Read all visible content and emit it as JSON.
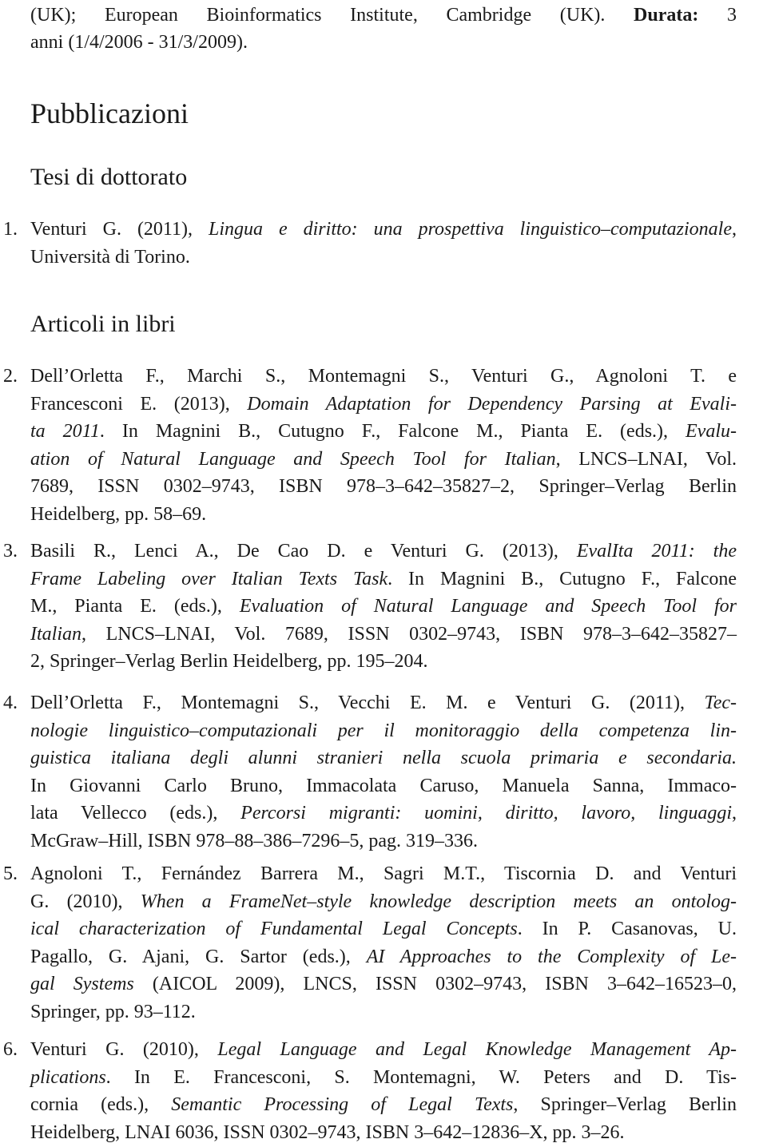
{
  "intro": {
    "line1_text": "(UK); European Bioinformatics Institute, Cambridge (UK).",
    "line1_bold": "Durata:",
    "line1_tail": " 3",
    "line2": "anni (1/4/2006 - 31/3/2009)."
  },
  "section_title": "Pubblicazioni",
  "subsections": [
    {
      "title": "Tesi di dottorato"
    },
    {
      "title": "Articoli in libri"
    }
  ],
  "entries": [
    {
      "number": "1.",
      "lines": [
        [
          {
            "t": "Venturi G. (2011), "
          },
          {
            "t": "Lingua e diritto: una prospettiva linguistico–computazionale",
            "i": true
          },
          {
            "t": ","
          }
        ],
        [
          {
            "t": "Università di Torino."
          }
        ]
      ]
    },
    {
      "number": "2.",
      "lines": [
        [
          {
            "t": "Dell’Orletta F., Marchi S., Montemagni S., Venturi G., Agnoloni T. e"
          }
        ],
        [
          {
            "t": "Francesconi E. (2013), "
          },
          {
            "t": "Domain Adaptation for Dependency Parsing at Evali-",
            "i": true
          }
        ],
        [
          {
            "t": "ta 2011",
            "i": true
          },
          {
            "t": ". In Magnini B., Cutugno F., Falcone M., Pianta E. (eds.), "
          },
          {
            "t": "Evalu-",
            "i": true
          }
        ],
        [
          {
            "t": "ation of Natural Language and Speech Tool for Italian",
            "i": true
          },
          {
            "t": ", LNCS–LNAI, Vol."
          }
        ],
        [
          {
            "t": "7689, ISSN 0302–9743, ISBN 978–3–642–35827–2, Springer–Verlag Berlin"
          }
        ],
        [
          {
            "t": "Heidelberg, pp. 58–69."
          }
        ]
      ]
    },
    {
      "number": "3.",
      "lines": [
        [
          {
            "t": "Basili R., Lenci A., De Cao D. e Venturi G. (2013), "
          },
          {
            "t": "EvalIta 2011: the",
            "i": true
          }
        ],
        [
          {
            "t": "Frame Labeling over Italian Texts Task",
            "i": true
          },
          {
            "t": ". In Magnini B., Cutugno F., Falcone"
          }
        ],
        [
          {
            "t": "M., Pianta E. (eds.), "
          },
          {
            "t": "Evaluation of Natural Language and Speech Tool for",
            "i": true
          }
        ],
        [
          {
            "t": "Italian",
            "i": true
          },
          {
            "t": ", LNCS–LNAI, Vol. 7689, ISSN 0302–9743, ISBN 978–3–642–35827–"
          }
        ],
        [
          {
            "t": "2, Springer–Verlag Berlin Heidelberg, pp. 195–204."
          }
        ]
      ]
    },
    {
      "number": "4.",
      "lines": [
        [
          {
            "t": "Dell’Orletta F., Montemagni S., Vecchi E. M. e Venturi G. (2011), "
          },
          {
            "t": "Tec-",
            "i": true
          }
        ],
        [
          {
            "t": "nologie linguistico–computazionali per il monitoraggio della competenza lin-",
            "i": true
          }
        ],
        [
          {
            "t": "guistica italiana degli alunni stranieri nella scuola primaria e secondaria.",
            "i": true
          }
        ],
        [
          {
            "t": "In Giovanni Carlo Bruno, Immacolata Caruso, Manuela Sanna, Immaco-"
          }
        ],
        [
          {
            "t": "lata Vellecco (eds.), "
          },
          {
            "t": "Percorsi migranti: uomini, diritto, lavoro, linguaggi",
            "i": true
          },
          {
            "t": ","
          }
        ],
        [
          {
            "t": "McGraw–Hill, ISBN 978–88–386–7296–5, pag. 319–336."
          }
        ]
      ]
    },
    {
      "number": "5.",
      "lines": [
        [
          {
            "t": "Agnoloni T., Fernández Barrera M., Sagri M.T., Tiscornia D. and Venturi"
          }
        ],
        [
          {
            "t": "G. (2010), "
          },
          {
            "t": "When a FrameNet–style knowledge description meets an ontolog-",
            "i": true
          }
        ],
        [
          {
            "t": "ical characterization of Fundamental Legal Concepts",
            "i": true
          },
          {
            "t": ". In P. Casanovas, U."
          }
        ],
        [
          {
            "t": "Pagallo, G. Ajani, G. Sartor (eds.), "
          },
          {
            "t": "AI Approaches to the Complexity of Le-",
            "i": true
          }
        ],
        [
          {
            "t": "gal Systems",
            "i": true
          },
          {
            "t": " (AICOL 2009), LNCS, ISSN 0302–9743, ISBN 3–642–16523–0,"
          }
        ],
        [
          {
            "t": "Springer, pp. 93–112."
          }
        ]
      ]
    },
    {
      "number": "6.",
      "lines": [
        [
          {
            "t": "Venturi G. (2010), "
          },
          {
            "t": "Legal Language and Legal Knowledge Management Ap-",
            "i": true
          }
        ],
        [
          {
            "t": "plications",
            "i": true
          },
          {
            "t": ".  In E. Francesconi, S. Montemagni, W. Peters and D. Tis-"
          }
        ],
        [
          {
            "t": "cornia (eds.), "
          },
          {
            "t": "Semantic Processing of Legal Texts",
            "i": true
          },
          {
            "t": ", Springer–Verlag Berlin"
          }
        ],
        [
          {
            "t": "Heidelberg, LNAI 6036, ISSN 0302–9743, ISBN 3–642–12836–X, pp. 3–26."
          }
        ]
      ]
    }
  ]
}
